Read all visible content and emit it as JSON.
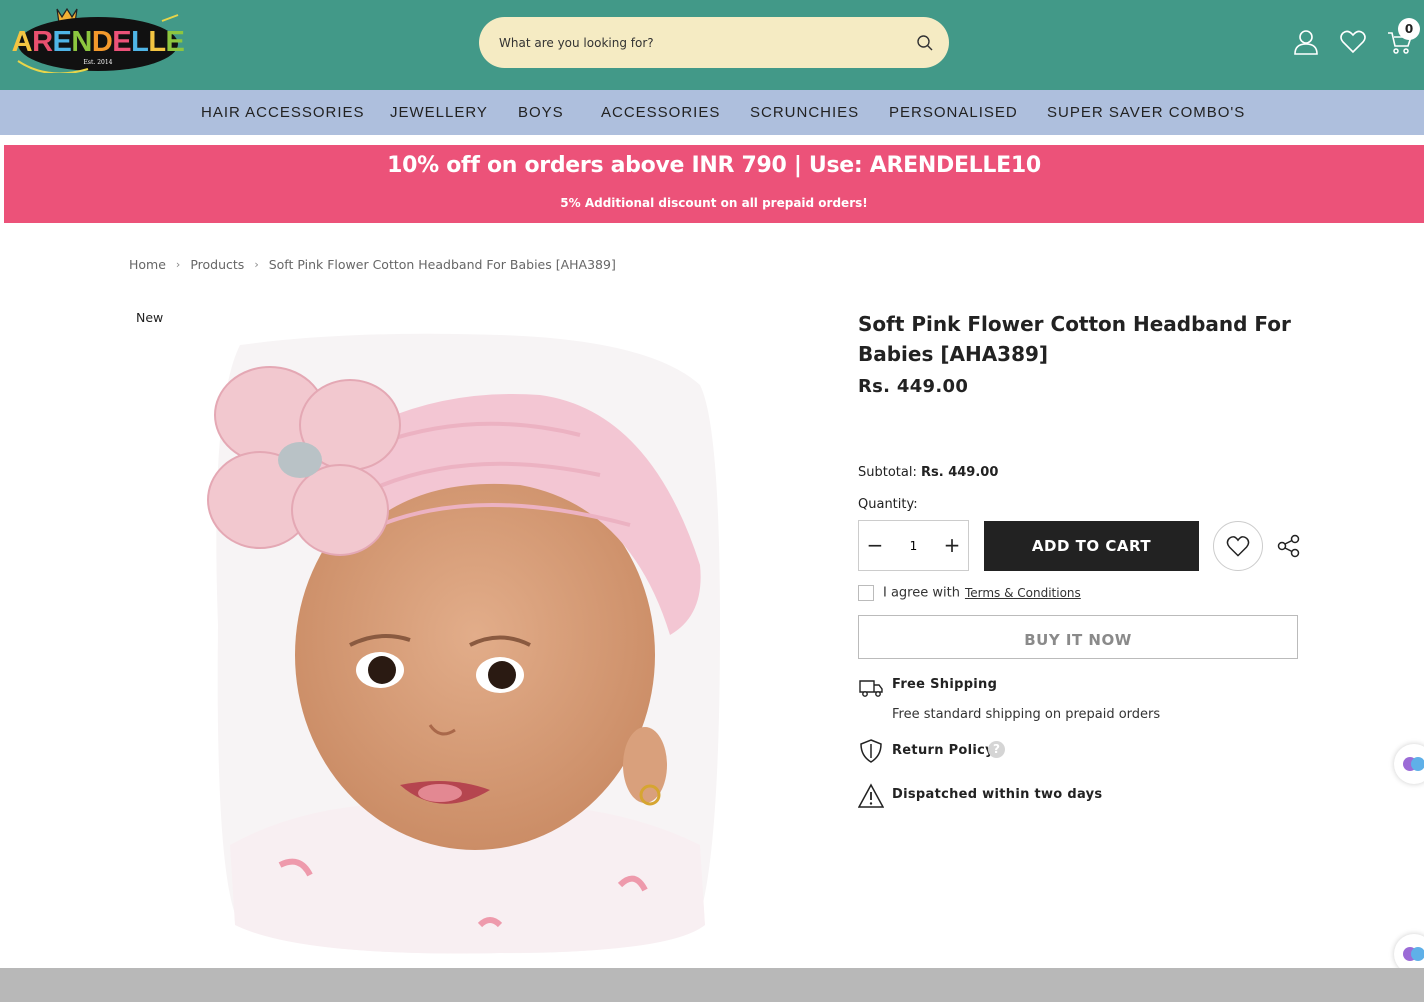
{
  "header": {
    "logo_text": "ARENDELLE",
    "logo_tagline": "Est. 2014",
    "search_placeholder": "What are you looking for?",
    "cart_count": "0"
  },
  "nav": {
    "items": [
      {
        "label": "HAIR ACCESSORIES"
      },
      {
        "label": "JEWELLERY"
      },
      {
        "label": "BOYS"
      },
      {
        "label": "ACCESSORIES"
      },
      {
        "label": "SCRUNCHIES"
      },
      {
        "label": "PERSONALISED"
      },
      {
        "label": "SUPER SAVER COMBO'S"
      }
    ]
  },
  "promo": {
    "main": "10% off on orders above INR 790 | Use: ARENDELLE10",
    "sub": "5% Additional discount on all prepaid orders!"
  },
  "breadcrumb": {
    "home": "Home",
    "products": "Products",
    "current": "Soft Pink Flower Cotton Headband For Babies [AHA389]"
  },
  "product": {
    "badge": "New",
    "title": "Soft Pink Flower Cotton Headband For Babies [AHA389]",
    "price": "Rs. 449.00",
    "subtotal_label": "Subtotal:",
    "subtotal_value": "Rs. 449.00",
    "quantity_label": "Quantity:",
    "quantity_value": "1",
    "add_to_cart": "ADD TO CART",
    "agree_text": "I agree with",
    "terms_link": "Terms & Conditions",
    "buy_now": "BUY IT NOW"
  },
  "features": [
    {
      "title": "Free Shipping",
      "desc": "Free standard shipping on prepaid orders",
      "icon": "truck-icon"
    },
    {
      "title": "Return Policy",
      "icon": "shield-icon"
    },
    {
      "title": "Dispatched within two days",
      "icon": "warning-icon"
    }
  ],
  "colors": {
    "header_bg": "#429988",
    "nav_bg": "#aebfdd",
    "promo_bg": "#ec5279",
    "search_bg": "#f5ebc3",
    "button_dark": "#222222"
  }
}
